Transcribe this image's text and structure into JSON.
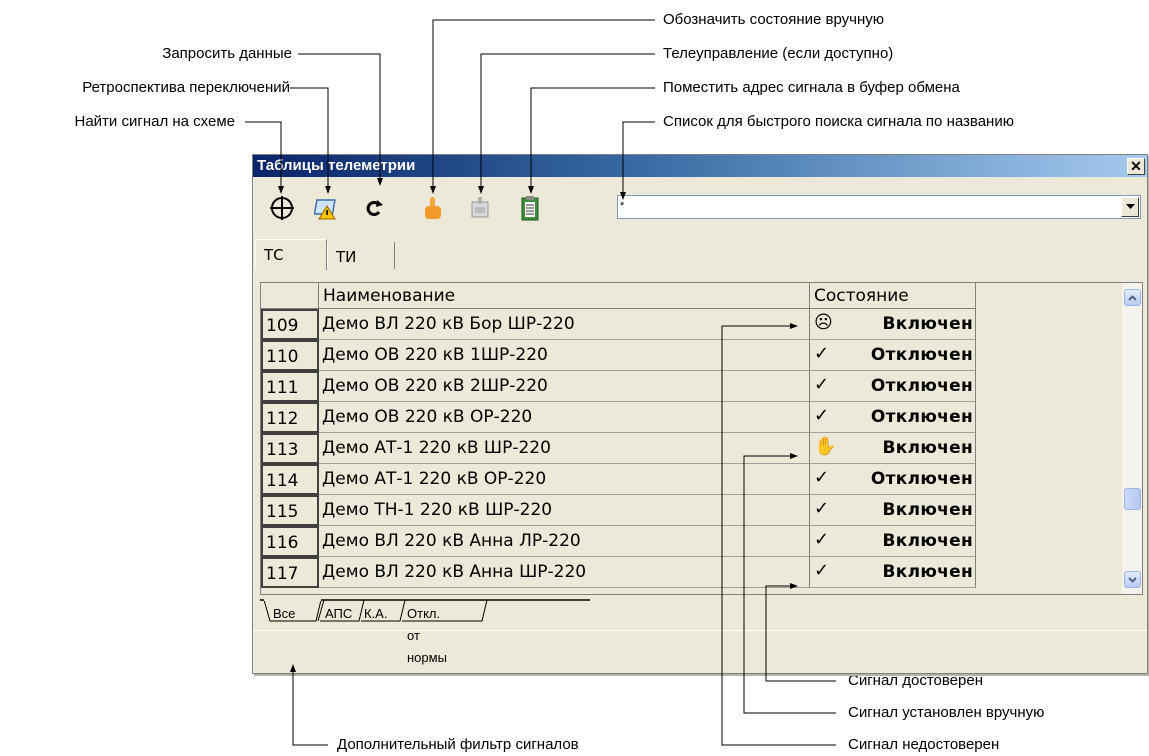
{
  "callouts": {
    "find_signal": "Найти сигнал на схеме",
    "retrospective": "Ретроспектива переключений",
    "request_data": "Запросить данные",
    "manual_state": "Обозначить состояние вручную",
    "telecontrol": "Телеуправление (если доступно)",
    "copy_address": "Поместить адрес сигнала в буфер обмена",
    "quick_search": "Список для быстрого поиска сигнала по названию",
    "signal_valid": "Сигнал достоверен",
    "signal_manual": "Сигнал установлен вручную",
    "signal_invalid": "Сигнал недостоверен",
    "extra_filter": "Дополнительный фильтр сигналов"
  },
  "window": {
    "title": "Таблицы телеметрии",
    "close": "✕"
  },
  "toolbar": {
    "icons": [
      "crosshair-icon",
      "retrospective-icon",
      "refresh-icon",
      "hand-pointer-icon",
      "telecontrol-icon",
      "clipboard-icon"
    ]
  },
  "search": {
    "value": "*"
  },
  "tabs": [
    "ТС",
    "ТИ"
  ],
  "table": {
    "columns": [
      "",
      "Наименование",
      "Состояние"
    ],
    "rows": [
      {
        "num": "109",
        "name": "Демо ВЛ 220 кВ Бор ШР-220",
        "icon": "☹",
        "state": "Включен"
      },
      {
        "num": "110",
        "name": "Демо ОВ 220 кВ 1ШР-220",
        "icon": "✓",
        "state": "Отключен"
      },
      {
        "num": "111",
        "name": "Демо ОВ 220 кВ 2ШР-220",
        "icon": "✓",
        "state": "Отключен"
      },
      {
        "num": "112",
        "name": "Демо ОВ 220 кВ ОР-220",
        "icon": "✓",
        "state": "Отключен"
      },
      {
        "num": "113",
        "name": "Демо АТ-1 220 кВ ШР-220",
        "icon": "✋",
        "state": "Включен"
      },
      {
        "num": "114",
        "name": "Демо АТ-1 220 кВ ОР-220",
        "icon": "✓",
        "state": "Отключен"
      },
      {
        "num": "115",
        "name": "Демо ТН-1 220 кВ ШР-220",
        "icon": "✓",
        "state": "Включен"
      },
      {
        "num": "116",
        "name": "Демо ВЛ 220 кВ Анна ЛР-220",
        "icon": "✓",
        "state": "Включен"
      },
      {
        "num": "117",
        "name": "Демо ВЛ 220 кВ Анна ШР-220",
        "icon": "✓",
        "state": "Включен"
      }
    ]
  },
  "filter_tabs": [
    "Все",
    "АПС",
    "К.А.",
    "Откл. от нормы"
  ]
}
